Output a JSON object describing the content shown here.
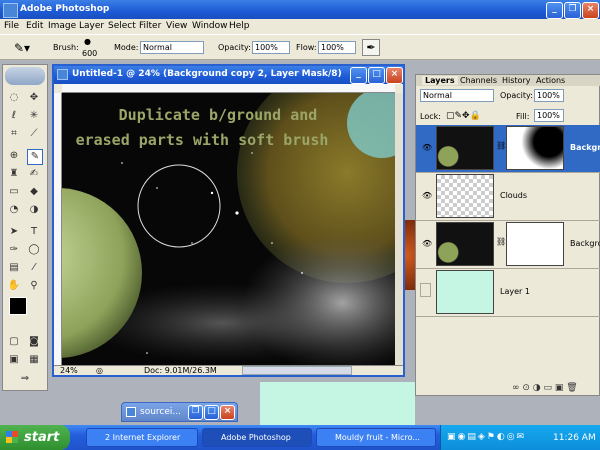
{
  "app": {
    "title": "Adobe Photoshop"
  },
  "menu": [
    "File",
    "Edit",
    "Image",
    "Layer",
    "Select",
    "Filter",
    "View",
    "Window",
    "Help"
  ],
  "options": {
    "brush_label": "Brush:",
    "brush_size": "600",
    "mode_label": "Mode:",
    "mode_value": "Normal",
    "opacity_label": "Opacity:",
    "opacity_value": "100%",
    "flow_label": "Flow:",
    "flow_value": "100%"
  },
  "document": {
    "title": "Untitled-1 @ 24% (Background copy 2, Layer Mask/8)",
    "canvas_text_line1": "Duplicate b/ground and",
    "canvas_text_line2": "erased parts with soft brush",
    "zoom": "24%",
    "doc_info": "Doc: 9.01M/26.3M"
  },
  "layers_panel": {
    "tabs": [
      "Layers",
      "Channels",
      "History",
      "Actions"
    ],
    "blend_mode": "Normal",
    "opacity_label": "Opacity:",
    "opacity_value": "100%",
    "lock_label": "Lock:",
    "fill_label": "Fill:",
    "fill_value": "100%",
    "layers": [
      {
        "name": "Backgro",
        "visible": true,
        "selected": true
      },
      {
        "name": "Clouds",
        "visible": true,
        "selected": false
      },
      {
        "name": "Backgro",
        "visible": true,
        "selected": false
      },
      {
        "name": "Layer 1",
        "visible": false,
        "selected": false
      }
    ]
  },
  "minimized_window": {
    "title": "sourcei..."
  },
  "taskbar": {
    "start": "start",
    "tasks": [
      {
        "label": "2 Internet Explorer",
        "active": false
      },
      {
        "label": "Adobe Photoshop",
        "active": true
      },
      {
        "label": "Mouldy fruit - Micro...",
        "active": false
      }
    ],
    "clock": "11:26 AM"
  },
  "colors": {
    "accent": "#245edb",
    "selected_layer": "#316ac5",
    "panel_bg": "#ece9d8",
    "canvas_text": "#9ba567"
  }
}
